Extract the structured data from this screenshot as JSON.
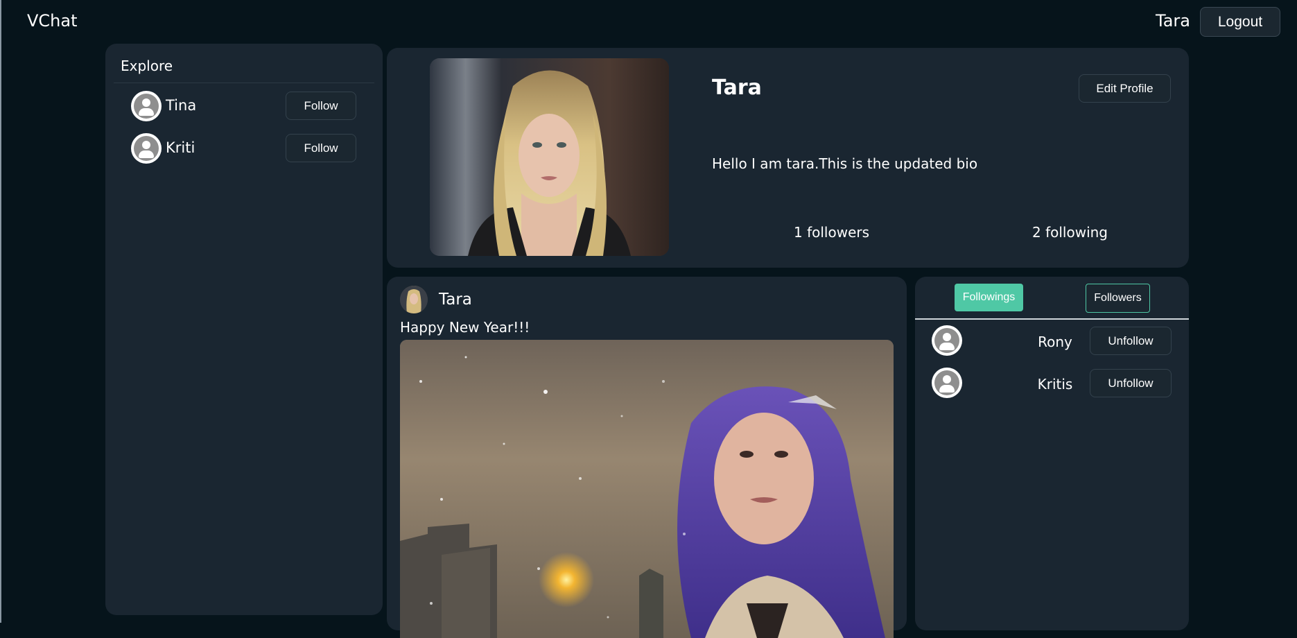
{
  "navbar": {
    "brand": "VChat",
    "username": "Tara",
    "logout_label": "Logout"
  },
  "explore": {
    "title": "Explore",
    "users": [
      {
        "name": "Tina",
        "button": "Follow"
      },
      {
        "name": "Kriti",
        "button": "Follow"
      }
    ]
  },
  "profile": {
    "name": "Tara",
    "edit_label": "Edit Profile",
    "bio": "Hello I am tara.This is the updated bio",
    "followers_text": "1 followers",
    "following_text": "2 following"
  },
  "post": {
    "author": "Tara",
    "caption": "Happy New Year!!!"
  },
  "follow_list": {
    "tabs": {
      "followings": "Followings",
      "followers": "Followers"
    },
    "active_tab": "Followings",
    "items": [
      {
        "name": "Rony",
        "button": "Unfollow"
      },
      {
        "name": "Kritis",
        "button": "Unfollow"
      }
    ]
  },
  "colors": {
    "page_bg": "#06141b",
    "panel_bg": "#1a2631",
    "accent": "#4fc8a5"
  }
}
